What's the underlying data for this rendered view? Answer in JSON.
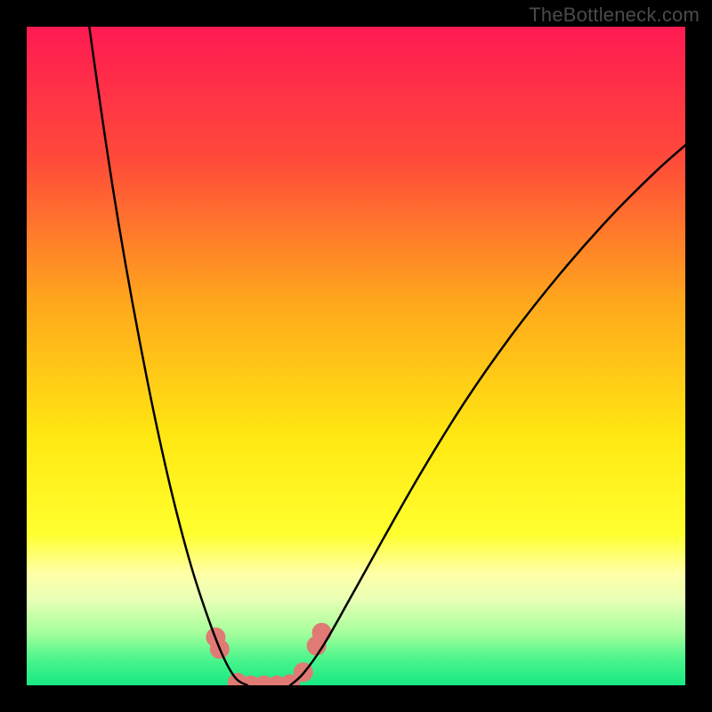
{
  "watermark": {
    "text": "TheBottleneck.com"
  },
  "chart_data": {
    "type": "line",
    "title": "",
    "xlabel": "",
    "ylabel": "",
    "xlim": [
      0,
      1
    ],
    "ylim": [
      0,
      1
    ],
    "background_stops": [
      {
        "offset": 0.0,
        "color": "#ff1a52"
      },
      {
        "offset": 0.2,
        "color": "#ff4a3a"
      },
      {
        "offset": 0.42,
        "color": "#ffa81c"
      },
      {
        "offset": 0.62,
        "color": "#ffe712"
      },
      {
        "offset": 0.77,
        "color": "#ffff2e"
      },
      {
        "offset": 0.83,
        "color": "#ffffa8"
      },
      {
        "offset": 0.87,
        "color": "#e8ffb5"
      },
      {
        "offset": 0.92,
        "color": "#a6ff9c"
      },
      {
        "offset": 0.96,
        "color": "#4cf58c"
      },
      {
        "offset": 1.0,
        "color": "#17e884"
      }
    ],
    "series": [
      {
        "name": "left-branch",
        "stroke": "#000000",
        "stroke_width": 2.5,
        "points": [
          {
            "x": 0.095,
            "y": 1.0
          },
          {
            "x": 0.112,
            "y": 0.88
          },
          {
            "x": 0.13,
            "y": 0.76
          },
          {
            "x": 0.15,
            "y": 0.64
          },
          {
            "x": 0.172,
            "y": 0.52
          },
          {
            "x": 0.196,
            "y": 0.4
          },
          {
            "x": 0.222,
            "y": 0.285
          },
          {
            "x": 0.25,
            "y": 0.18
          },
          {
            "x": 0.278,
            "y": 0.095
          },
          {
            "x": 0.3,
            "y": 0.04
          },
          {
            "x": 0.318,
            "y": 0.01
          },
          {
            "x": 0.335,
            "y": 0.0
          }
        ]
      },
      {
        "name": "right-branch",
        "stroke": "#000000",
        "stroke_width": 2.5,
        "points": [
          {
            "x": 0.4,
            "y": 0.0
          },
          {
            "x": 0.42,
            "y": 0.018
          },
          {
            "x": 0.45,
            "y": 0.06
          },
          {
            "x": 0.49,
            "y": 0.13
          },
          {
            "x": 0.54,
            "y": 0.22
          },
          {
            "x": 0.6,
            "y": 0.325
          },
          {
            "x": 0.665,
            "y": 0.43
          },
          {
            "x": 0.735,
            "y": 0.53
          },
          {
            "x": 0.81,
            "y": 0.625
          },
          {
            "x": 0.885,
            "y": 0.71
          },
          {
            "x": 0.955,
            "y": 0.78
          },
          {
            "x": 1.0,
            "y": 0.82
          }
        ]
      }
    ],
    "highlight_zone": {
      "name": "valley-markers",
      "color": "#e07a74",
      "radius": 11,
      "points": [
        {
          "x": 0.287,
          "y": 0.073
        },
        {
          "x": 0.293,
          "y": 0.055
        },
        {
          "x": 0.32,
          "y": 0.004
        },
        {
          "x": 0.34,
          "y": 0.0
        },
        {
          "x": 0.36,
          "y": 0.0
        },
        {
          "x": 0.38,
          "y": 0.0
        },
        {
          "x": 0.4,
          "y": 0.002
        },
        {
          "x": 0.42,
          "y": 0.02
        },
        {
          "x": 0.44,
          "y": 0.06
        },
        {
          "x": 0.448,
          "y": 0.08
        }
      ]
    }
  }
}
